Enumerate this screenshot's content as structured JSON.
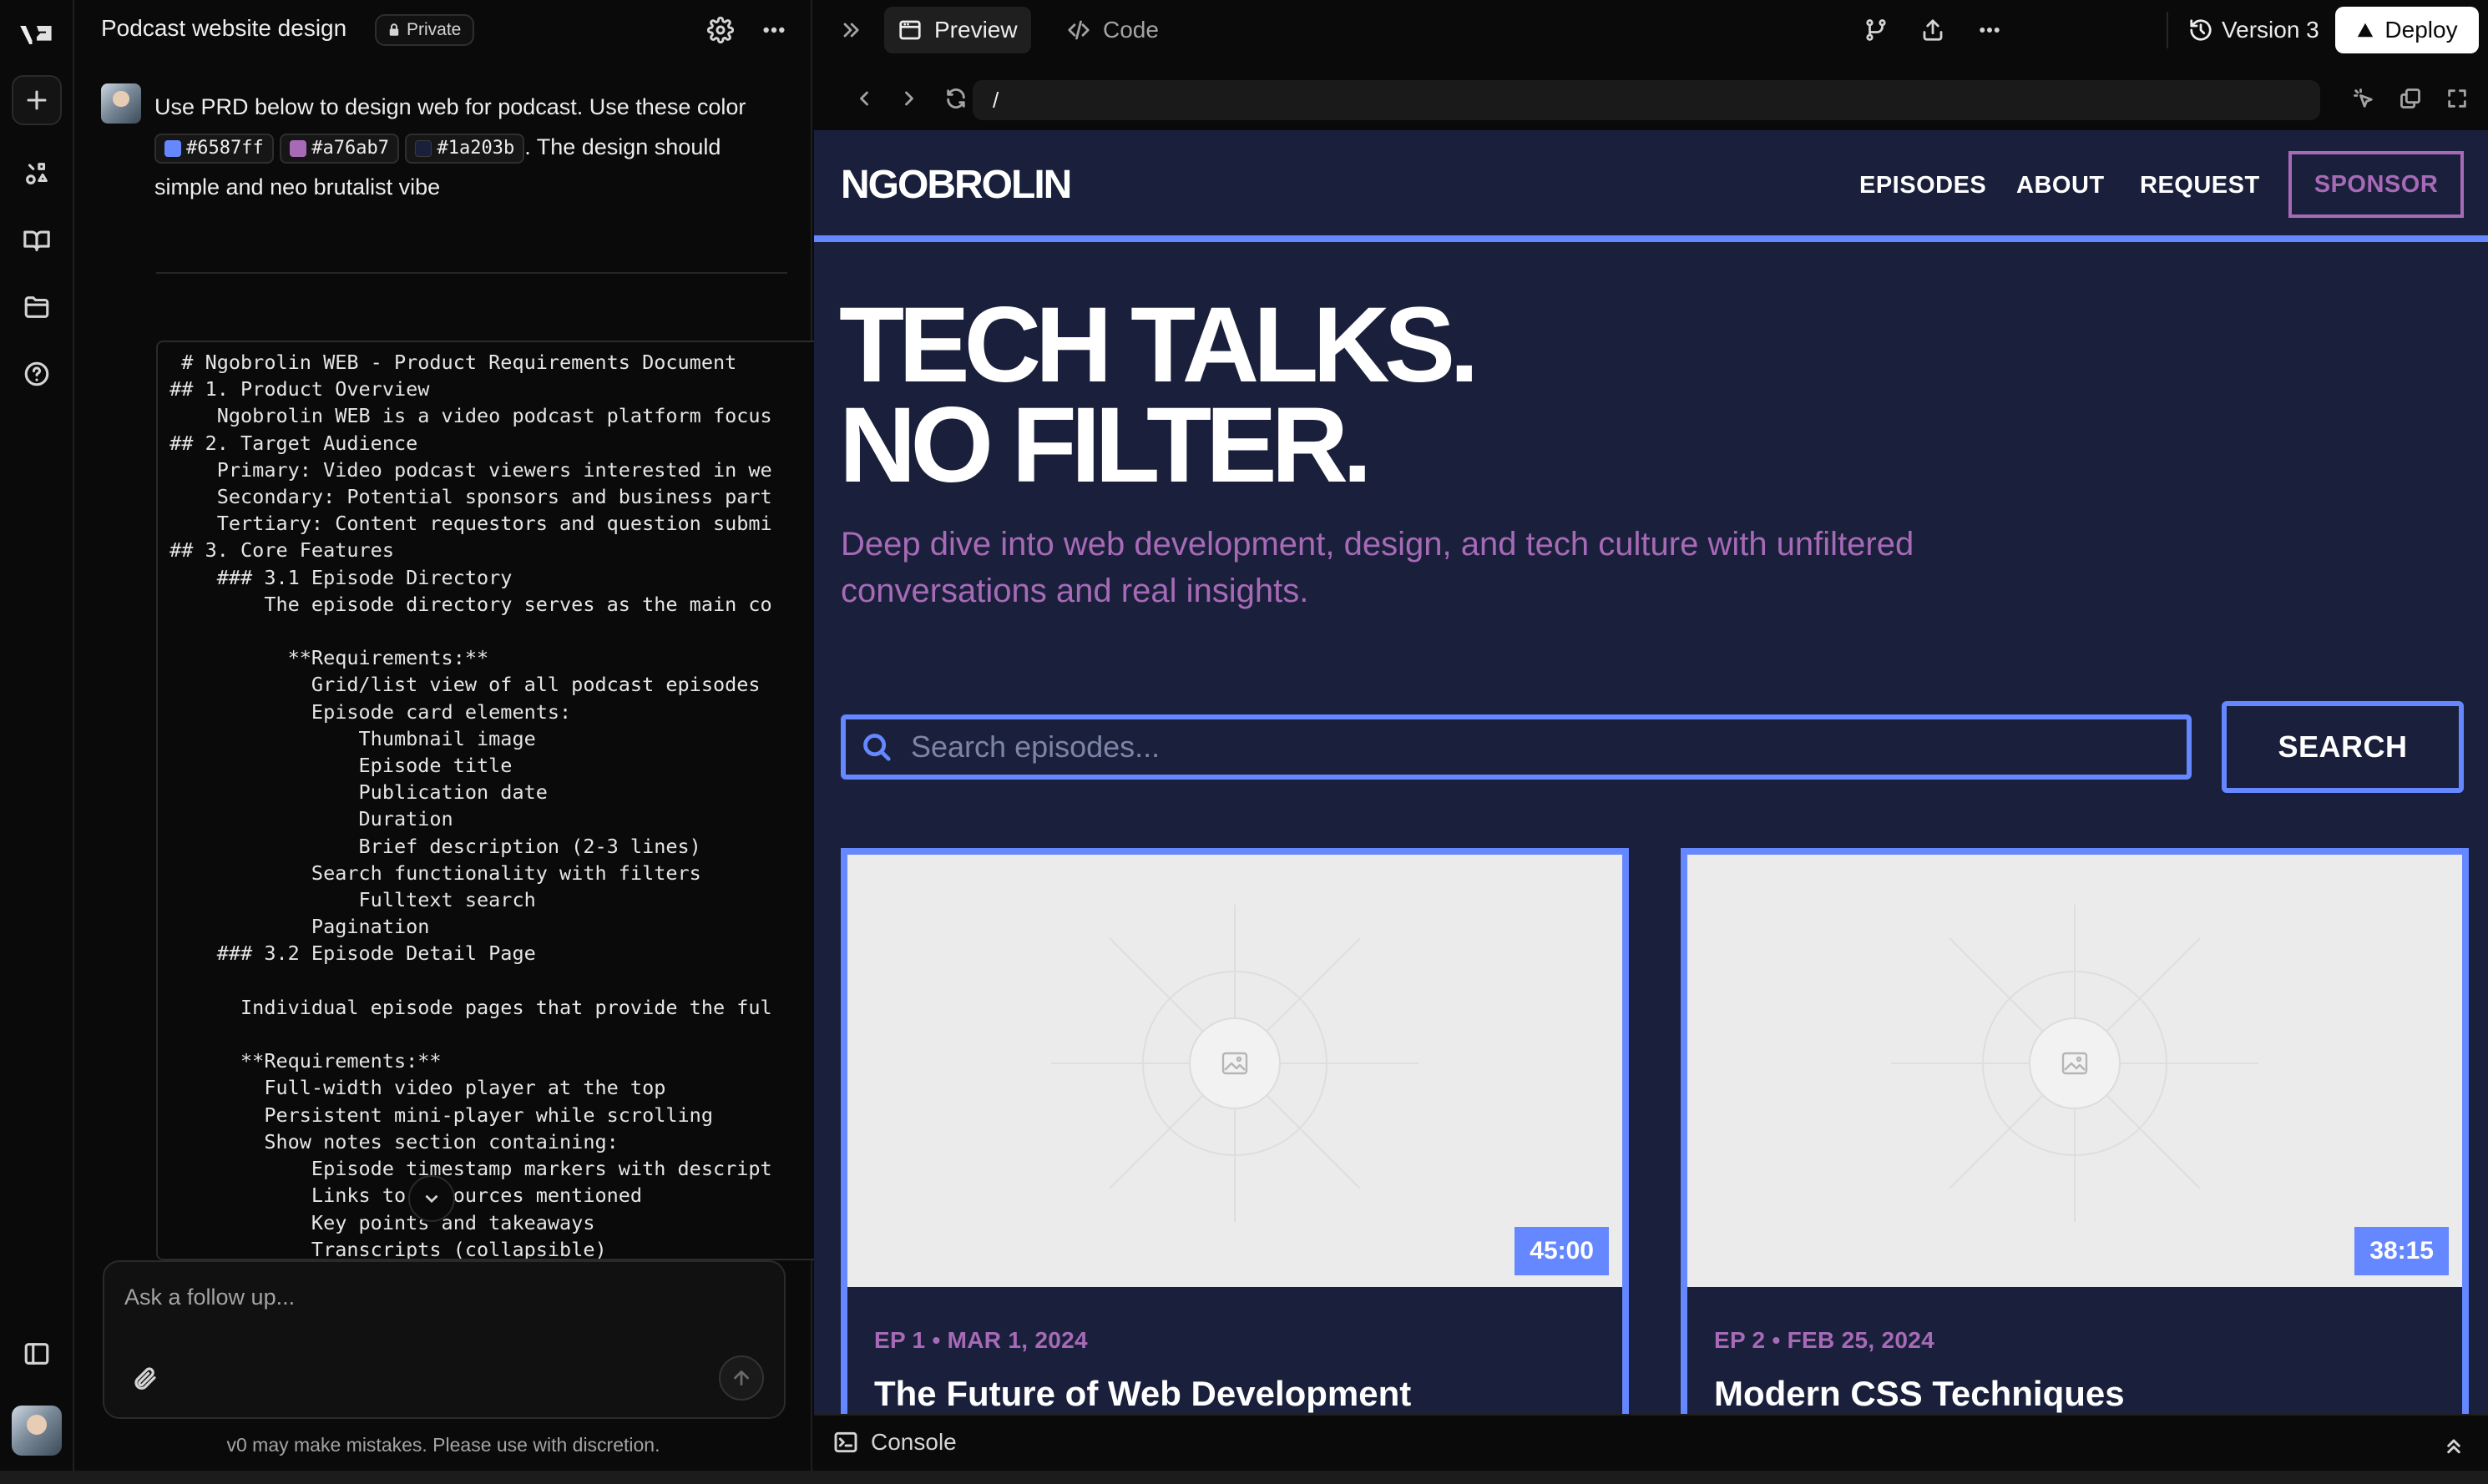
{
  "chat": {
    "title": "Podcast website design",
    "private_label": "Private",
    "message": {
      "text_before": "Use PRD below to design web for podcast. Use these color",
      "colors": [
        {
          "hex": "#6587ff",
          "label": "#6587ff"
        },
        {
          "hex": "#a76ab7",
          "label": "#a76ab7"
        },
        {
          "hex": "#1a203b",
          "label": "#1a203b"
        }
      ],
      "text_after": ". The design should simple and neo brutalist vibe"
    },
    "prd_text": "  # Ngobrolin WEB - Product Requirements Document\n ## 1. Product Overview\n     Ngobrolin WEB is a video podcast platform focus\n ## 2. Target Audience\n     Primary: Video podcast viewers interested in we\n     Secondary: Potential sponsors and business part\n     Tertiary: Content requestors and question submi\n ## 3. Core Features\n     ### 3.1 Episode Directory\n         The episode directory serves as the main co\n\n           **Requirements:**\n             Grid/list view of all podcast episodes\n             Episode card elements:\n                 Thumbnail image\n                 Episode title\n                 Publication date\n                 Duration\n                 Brief description (2-3 lines)\n             Search functionality with filters\n                 Fulltext search\n             Pagination\n     ### 3.2 Episode Detail Page\n\n       Individual episode pages that provide the ful\n\n       **Requirements:**\n         Full-width video player at the top\n         Persistent mini-player while scrolling\n         Show notes section containing:\n             Episode timestamp markers with descript\n             Links to resources mentioned\n             Key points and takeaways\n             Transcripts (collapsible)",
    "composer_placeholder": "Ask a follow up...",
    "disclaimer": "v0 may make mistakes. Please use with discretion."
  },
  "workspace": {
    "tabs": [
      {
        "label": "Preview"
      },
      {
        "label": "Code"
      }
    ],
    "version_label": "Version 3",
    "deploy_label": "Deploy",
    "url": "/",
    "console_label": "Console"
  },
  "site": {
    "logo": "NGOBROLIN",
    "nav": [
      "EPISODES",
      "ABOUT",
      "REQUEST"
    ],
    "sponsor_label": "SPONSOR",
    "hero_line1": "TECH TALKS.",
    "hero_line2": "NO FILTER.",
    "hero_subtitle": "Deep dive into web development, design, and tech culture with unfiltered conversations and real insights.",
    "search_placeholder": "Search episodes...",
    "search_button": "SEARCH",
    "episodes": [
      {
        "meta": "EP 1 • MAR 1, 2024",
        "title": "The Future of Web Development",
        "duration": "45:00"
      },
      {
        "meta": "EP 2 • FEB 25, 2024",
        "title": "Modern CSS Techniques",
        "duration": "38:15"
      }
    ],
    "colors": {
      "primary": "#6587ff",
      "accent": "#a76ab7",
      "background": "#1a203b"
    }
  }
}
